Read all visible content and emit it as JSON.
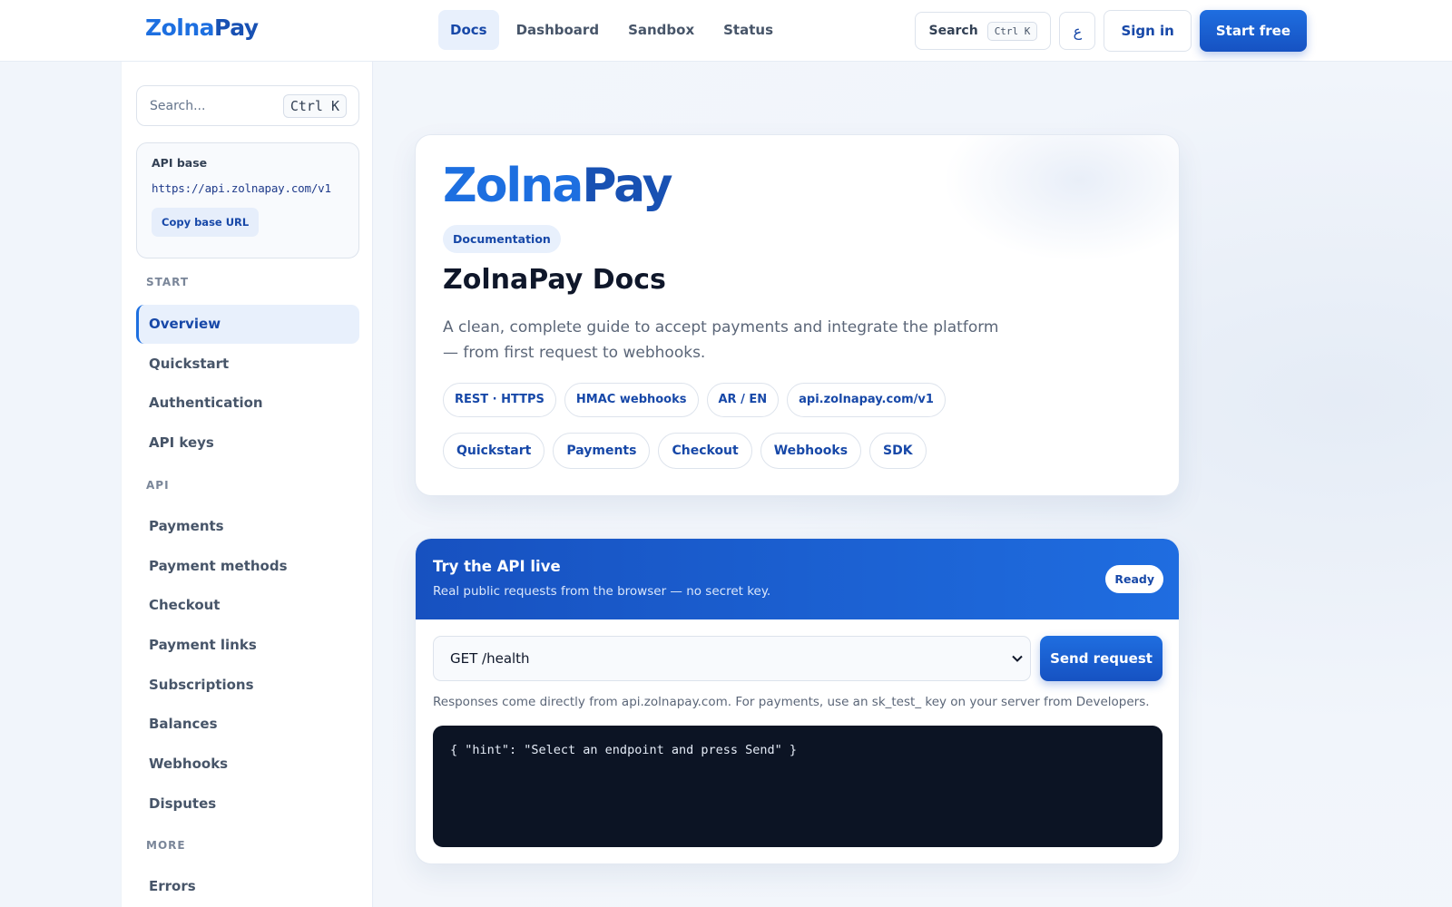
{
  "brand": {
    "part1": "Zolna",
    "part2": "Pay"
  },
  "nav": {
    "links": [
      "Docs",
      "Dashboard",
      "Sandbox",
      "Status"
    ],
    "search_label": "Search",
    "search_kbd": "Ctrl K",
    "lang": "ع",
    "signin": "Sign in",
    "start": "Start free"
  },
  "sidebar": {
    "search_placeholder": "Search...",
    "search_kbd": "Ctrl K",
    "api_base_label": "API base",
    "api_base_url": "https://api.zolnapay.com/v1",
    "copy_label": "Copy base URL",
    "sections": {
      "start": "START",
      "api": "API",
      "more": "MORE"
    },
    "start_items": [
      "Overview",
      "Quickstart",
      "Authentication",
      "API keys"
    ],
    "api_items": [
      "Payments",
      "Payment methods",
      "Checkout",
      "Payment links",
      "Subscriptions",
      "Balances",
      "Webhooks",
      "Disputes"
    ],
    "more_items": [
      "Errors"
    ],
    "active": "Overview"
  },
  "hero": {
    "logo1": "Zolna",
    "logo2": "Pay",
    "badge": "Documentation",
    "title": "ZolnaPay Docs",
    "desc": "A clean, complete guide to accept payments and integrate the platform — from first request to webhooks.",
    "tags": [
      "REST · HTTPS",
      "HMAC webhooks",
      "AR / EN",
      "api.zolnapay.com/v1"
    ],
    "links": [
      "Quickstart",
      "Payments",
      "Checkout",
      "Webhooks",
      "SDK"
    ]
  },
  "tryapi": {
    "title": "Try the API live",
    "subtitle": "Real public requests from the browser — no secret key.",
    "status": "Ready",
    "selected_endpoint": "GET /health",
    "send": "Send request",
    "note": "Responses come directly from api.zolnapay.com. For payments, use an sk_test_ key on your server from Developers.",
    "response": "{ \"hint\": \"Select an endpoint and press Send\" }"
  },
  "colors": {
    "primary": "#1d6fe0",
    "primary_dark": "#1748a8",
    "code_bg": "#0c1424"
  }
}
